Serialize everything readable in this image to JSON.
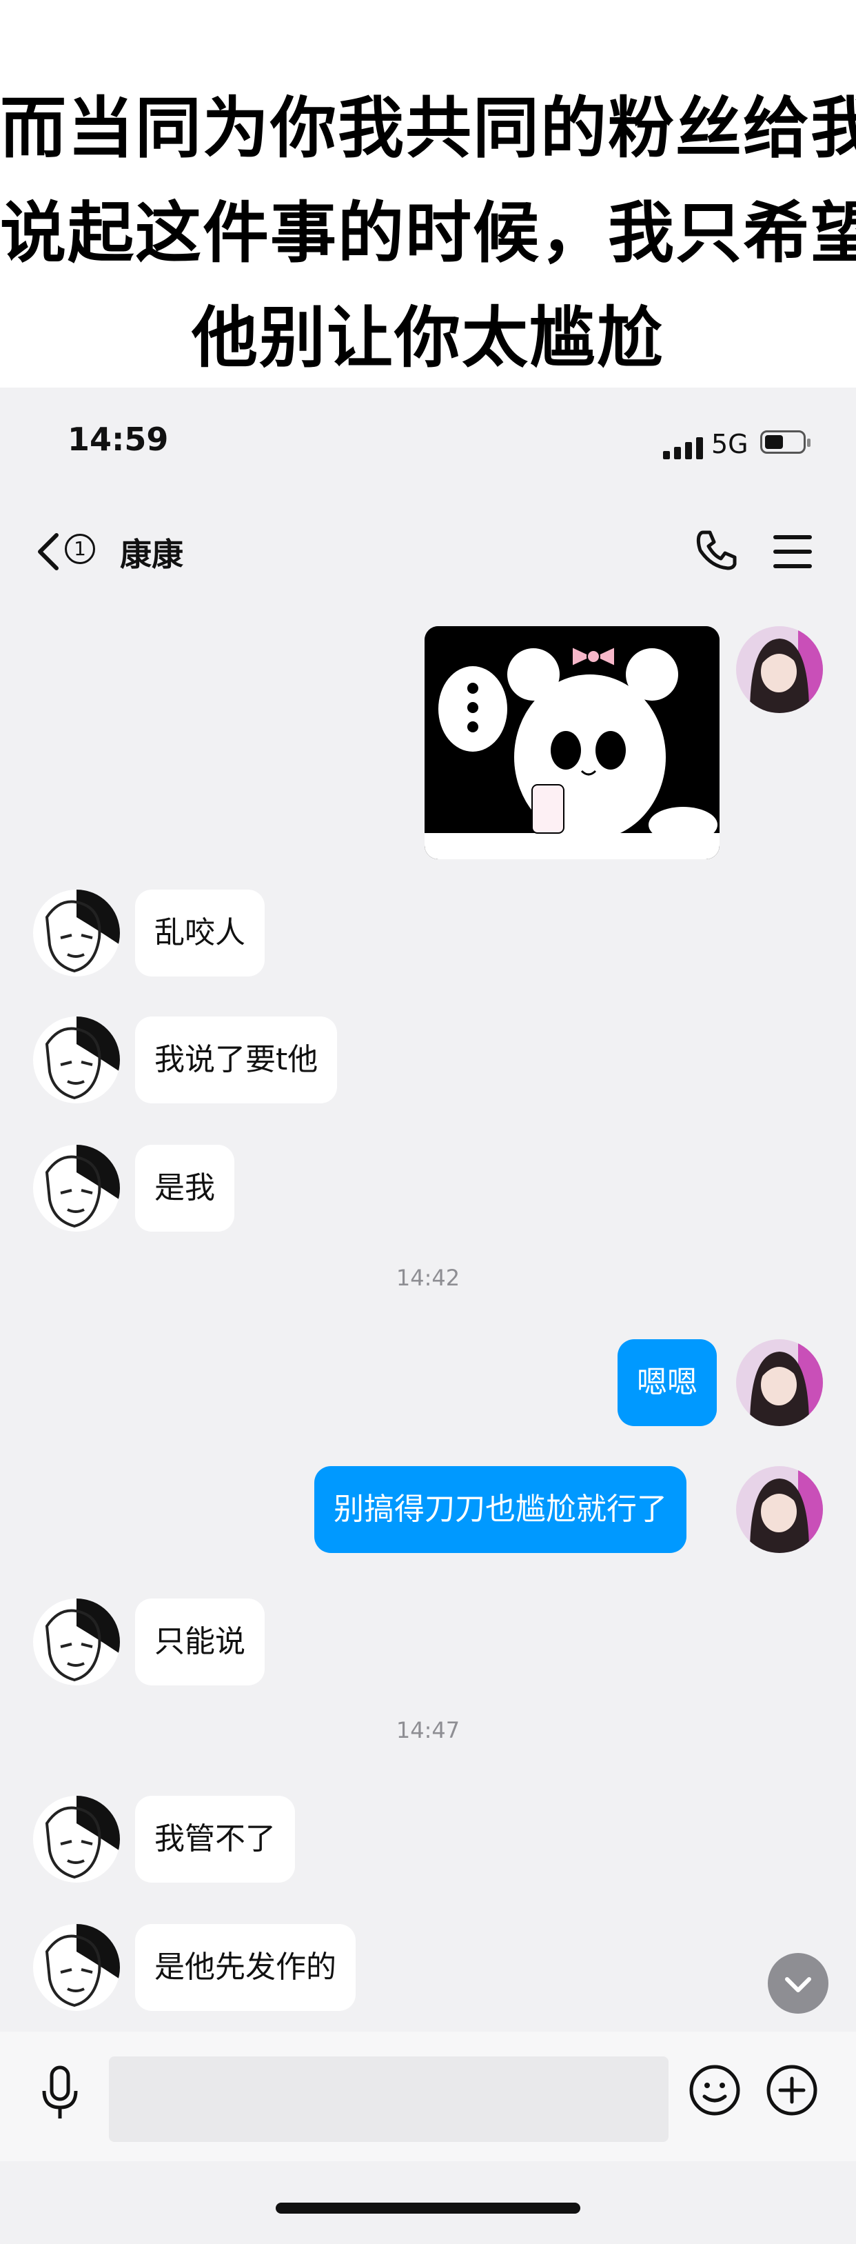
{
  "caption": {
    "lines": [
      "而当同为你我共同的粉丝给我",
      "说起这件事的时候，我只希望",
      "他别让你太尴尬"
    ]
  },
  "status_bar": {
    "time": "14:59",
    "network": "5G"
  },
  "nav": {
    "unread_count": "1",
    "contact_name": "康康"
  },
  "messages": [
    {
      "side": "right",
      "type": "sticker"
    },
    {
      "side": "left",
      "text": "乱咬人"
    },
    {
      "side": "left",
      "text": "我说了要t他"
    },
    {
      "side": "left",
      "text": "是我"
    },
    {
      "type": "timestamp",
      "text": "14:42"
    },
    {
      "side": "right",
      "text": "嗯嗯"
    },
    {
      "side": "right",
      "text": "别搞得刀刀也尴尬就行了"
    },
    {
      "side": "left",
      "text": "只能说"
    },
    {
      "type": "timestamp",
      "text": "14:47"
    },
    {
      "side": "left",
      "text": "我管不了"
    },
    {
      "side": "left",
      "text": "是他先发作的"
    }
  ],
  "input_bar": {
    "placeholder": ""
  },
  "colors": {
    "accent": "#0099ff",
    "background": "#f1f1f3",
    "bubble_left": "#ffffff"
  }
}
